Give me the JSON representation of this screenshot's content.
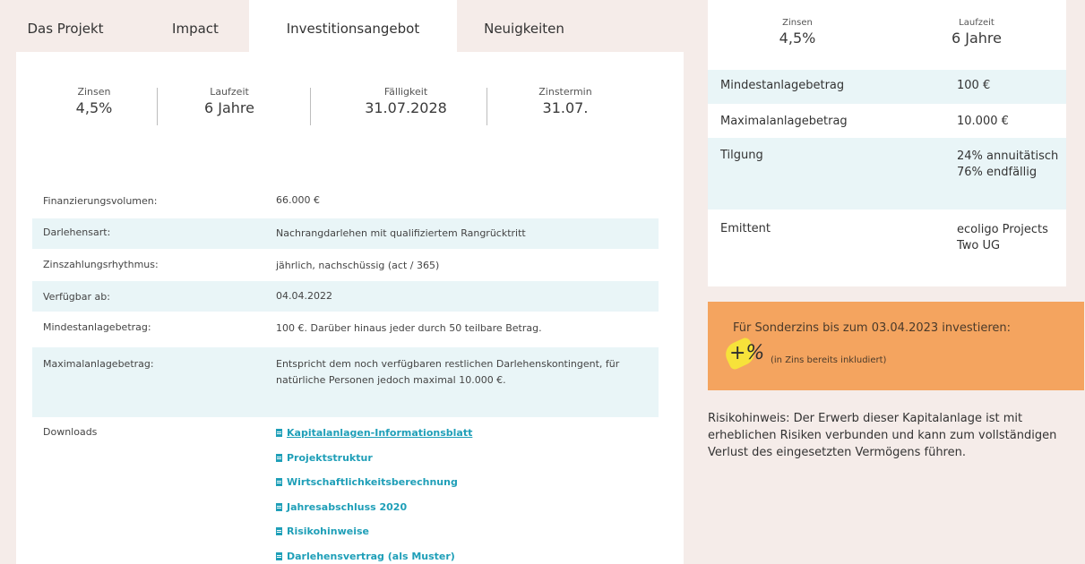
{
  "tabs": [
    "Das Projekt",
    "Impact",
    "Investitionsangebot",
    "Neuigkeiten"
  ],
  "kpis": [
    {
      "label": "Zinsen",
      "value": "4,5%"
    },
    {
      "label": "Laufzeit",
      "value": "6 Jahre"
    },
    {
      "label": "Fälligkeit",
      "value": "31.07.2028"
    },
    {
      "label": "Zinstermin",
      "value": "31.07."
    }
  ],
  "details": [
    {
      "key": "Finanzierungsvolumen:",
      "value": "66.000 €"
    },
    {
      "key": "Darlehensart:",
      "value": "Nachrangdarlehen mit qualifiziertem Rangrücktritt"
    },
    {
      "key": "Zinszahlungsrhythmus:",
      "value": "jährlich, nachschüssig (act / 365)"
    },
    {
      "key": "Verfügbar ab:",
      "value": "04.04.2022"
    },
    {
      "key": "Mindestanlagebetrag:",
      "value": "100 €. Darüber hinaus jeder durch 50 teilbare Betrag."
    },
    {
      "key": "Maximalanlagebetrag:",
      "value": "Entspricht dem noch verfügbaren restlichen Darlehenskontingent, für natürliche Personen jedoch maximal 10.000 €."
    }
  ],
  "downloads": {
    "label": "Downloads",
    "items": [
      "Kapitalanlagen-Informationsblatt",
      "Projektstruktur",
      "Wirtschaftlichkeitsberechnung",
      "Jahresabschluss 2020",
      "Risikohinweise",
      "Darlehensvertrag (als Muster)"
    ]
  },
  "summary": {
    "kpis": [
      {
        "label": "Zinsen",
        "value": "4,5%"
      },
      {
        "label": "Laufzeit",
        "value": "6 Jahre"
      }
    ],
    "rows": [
      {
        "key": "Mindestanlagebetrag",
        "value": "100 €"
      },
      {
        "key": "Maximalanlagebetrag",
        "value": "10.000 €"
      },
      {
        "key": "Tilgung",
        "value": "24% annuitätisch 76% endfällig"
      },
      {
        "key": "Emittent",
        "value": "ecoligo Projects Two UG"
      }
    ]
  },
  "promo": {
    "text": "Für Sonderzins bis zum 03.04.2023 investieren:",
    "badge": "+%",
    "note": "(in Zins bereits inkludiert)"
  },
  "risk": "Risikohinweis: Der Erwerb dieser Kapitalanlage ist mit erheblichen Risiken verbunden und kann zum vollständigen Verlust des eingesetzten Vermögens führen.",
  "colors": {
    "accent": "#1f9fb8",
    "promo": "#f4a45f",
    "shade": "#e9f5f7",
    "background": "#f5ece9"
  }
}
